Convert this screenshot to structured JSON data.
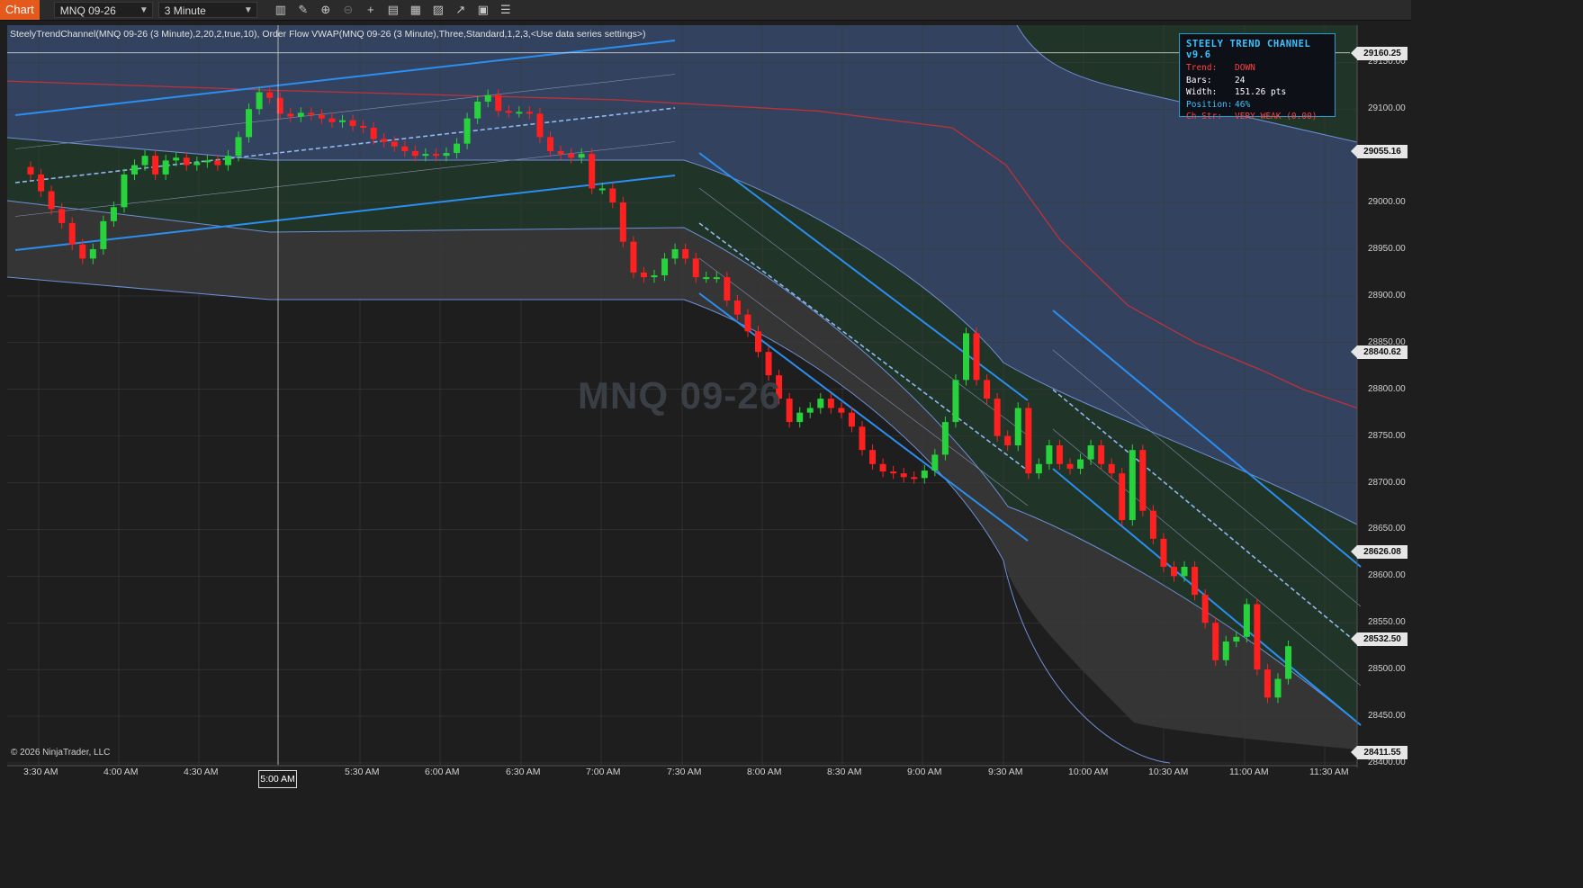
{
  "toolbar": {
    "tab": "Chart",
    "instrument": "MNQ 09-26",
    "interval": "3 Minute",
    "tools": [
      "bar-type-icon",
      "draw-tool-icon",
      "zoom-in-icon",
      "zoom-out-icon",
      "crosshair-icon",
      "data-box-icon",
      "properties-icon",
      "indicators-icon",
      "strategies-icon",
      "templates-icon",
      "chart-trader-icon"
    ]
  },
  "indicator_label": "SteelyTrendChannel(MNQ 09-26 (3 Minute),2,20,2,true,10), Order Flow VWAP(MNQ 09-26 (3 Minute),Three,Standard,1,2,3,<Use data series settings>)",
  "watermark": "MNQ 09-26",
  "copyright": "© 2026 NinjaTrader, LLC",
  "info_box": {
    "title": "STEELY TREND CHANNEL v9.6",
    "rows": [
      {
        "key": "Trend:",
        "val": "DOWN",
        "color": "#ff4040"
      },
      {
        "key": "Bars:",
        "val": "24",
        "color": "#ffffff"
      },
      {
        "key": "Width:",
        "val": "151.26 pts",
        "color": "#ffffff"
      },
      {
        "key": "Position:",
        "val": "46%",
        "color": "#3ec0ff"
      },
      {
        "key": "Ch Str:",
        "val": "VERY WEAK (0.00)",
        "color": "#ff4040"
      }
    ]
  },
  "crosshair_time": "5:00 AM",
  "chart_data": {
    "type": "candlestick",
    "ylim": [
      28400,
      29185
    ],
    "x_ticks": [
      "3:30 AM",
      "4:00 AM",
      "4:30 AM",
      "5:00 AM",
      "5:30 AM",
      "6:00 AM",
      "6:30 AM",
      "7:00 AM",
      "7:30 AM",
      "8:00 AM",
      "8:30 AM",
      "9:00 AM",
      "9:30 AM",
      "10:00 AM",
      "10:30 AM",
      "11:00 AM",
      "11:30 AM"
    ],
    "y_ticks": [
      "29150.00",
      "29100.00",
      "29000.00",
      "28950.00",
      "28900.00",
      "28850.00",
      "28800.00",
      "28750.00",
      "28700.00",
      "28650.00",
      "28600.00",
      "28550.00",
      "28500.00",
      "28450.00",
      "28400.00"
    ],
    "price_tags": [
      {
        "label": "29160.25",
        "value": 29160.25
      },
      {
        "label": "29055.16",
        "value": 29055.16
      },
      {
        "label": "28840.62",
        "value": 28840.62
      },
      {
        "label": "28626.08",
        "value": 28626.08
      },
      {
        "label": "28532.50",
        "value": 28532.5
      },
      {
        "label": "28411.55",
        "value": 28411.55
      }
    ],
    "closes": [
      29030,
      29012,
      28993,
      28978,
      28955,
      28940,
      28950,
      28980,
      28995,
      29030,
      29040,
      29050,
      29030,
      29045,
      29048,
      29040,
      29043,
      29045,
      29040,
      29050,
      29070,
      29100,
      29118,
      29112,
      29095,
      29092,
      29096,
      29094,
      29090,
      29086,
      29088,
      29082,
      29080,
      29068,
      29065,
      29060,
      29055,
      29050,
      29052,
      29050,
      29053,
      29063,
      29090,
      29108,
      29115,
      29098,
      29097,
      29097,
      29095,
      29070,
      29055,
      29052,
      29048,
      29052,
      29015,
      29015,
      29000,
      28958,
      28925,
      28920,
      28922,
      28940,
      28950,
      28940,
      28920,
      28920,
      28920,
      28895,
      28880,
      28862,
      28840,
      28815,
      28790,
      28765,
      28775,
      28780,
      28790,
      28780,
      28775,
      28760,
      28735,
      28720,
      28712,
      28710,
      28706,
      28705,
      28713,
      28730,
      28765,
      28810,
      28860,
      28810,
      28790,
      28750,
      28740,
      28780,
      28710,
      28720,
      28740,
      28720,
      28715,
      28725,
      28740,
      28720,
      28710,
      28660,
      28735,
      28670,
      28640,
      28610,
      28600,
      28610,
      28580,
      28550,
      28510,
      28530,
      28535,
      28570,
      28500,
      28470,
      28490,
      28525
    ],
    "vwap": [
      [
        0,
        29130
      ],
      [
        0.2,
        29120
      ],
      [
        0.45,
        29110
      ],
      [
        0.6,
        29098
      ],
      [
        0.7,
        29080
      ],
      [
        0.74,
        29040
      ],
      [
        0.78,
        28960
      ],
      [
        0.83,
        28890
      ],
      [
        0.88,
        28850
      ],
      [
        0.93,
        28820
      ],
      [
        0.96,
        28800
      ],
      [
        1,
        28780
      ]
    ]
  }
}
